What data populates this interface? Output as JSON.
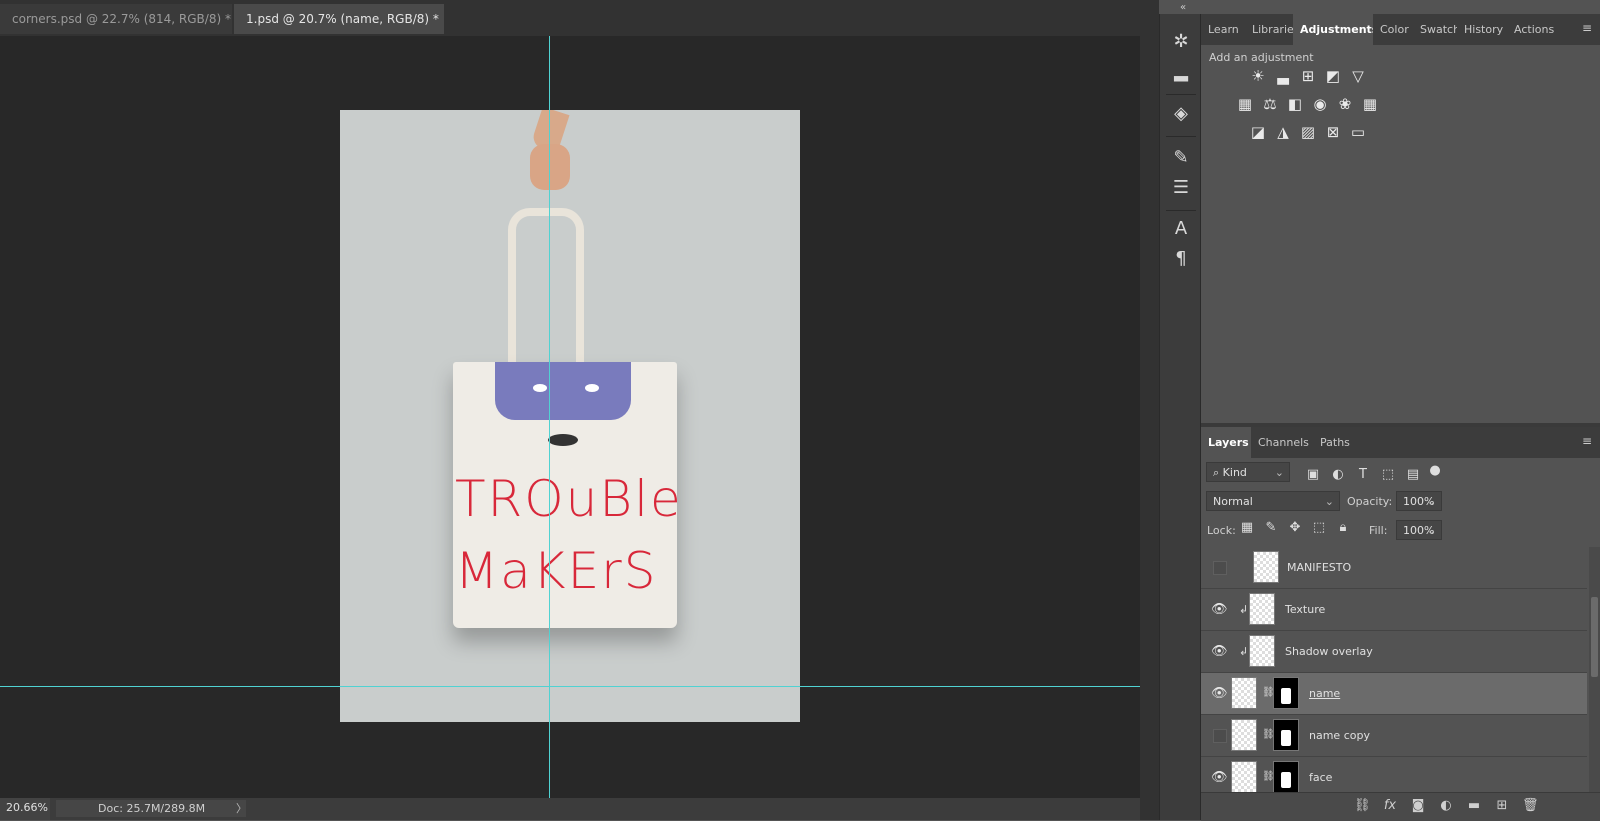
{
  "tabs": [
    {
      "label": "corners.psd @ 22.7% (814, RGB/8) *",
      "close": "×"
    },
    {
      "label": "1.psd @ 20.7% (name, RGB/8) *",
      "close": "×"
    }
  ],
  "artwork": {
    "line1": "TROuBle",
    "line2": "MaKErS"
  },
  "status": {
    "zoom": "20.66%",
    "doc": "Doc: 25.7M/289.8M",
    "arrow": "〉"
  },
  "toolstrip": {
    "collapse_icon": "«"
  },
  "panel_top": {
    "tabs": [
      "Learn",
      "Libraries",
      "Adjustments",
      "Color",
      "Swatches",
      "History",
      "Actions"
    ],
    "active_tab": "Adjustments",
    "add_label": "Add an adjustment",
    "adjustment_icons": [
      "brightness-contrast-icon",
      "levels-icon",
      "curves-icon",
      "exposure-icon",
      "vibrance-icon",
      "hue-saturation-icon",
      "color-balance-icon",
      "black-white-icon",
      "photo-filter-icon",
      "channel-mixer-icon",
      "color-lookup-icon",
      "invert-icon",
      "posterize-icon",
      "threshold-icon",
      "selective-color-icon",
      "gradient-map-icon"
    ]
  },
  "panel_layers": {
    "tabs": [
      "Layers",
      "Channels",
      "Paths"
    ],
    "active_tab": "Layers",
    "filter_kind": "Kind",
    "blend_mode": "Normal",
    "opacity_label": "Opacity:",
    "opacity": "100%",
    "lock_label": "Lock:",
    "fill_label": "Fill:",
    "fill": "100%",
    "layers": [
      {
        "name": "MANIFESTO",
        "visible": false,
        "clipped": false,
        "mask": false,
        "selected": false
      },
      {
        "name": "Texture",
        "visible": true,
        "clipped": true,
        "mask": false,
        "selected": false
      },
      {
        "name": "Shadow overlay",
        "visible": true,
        "clipped": true,
        "mask": false,
        "selected": false
      },
      {
        "name": "name",
        "visible": true,
        "clipped": false,
        "mask": true,
        "selected": true
      },
      {
        "name": "name copy",
        "visible": false,
        "clipped": false,
        "mask": true,
        "selected": false
      },
      {
        "name": "face",
        "visible": true,
        "clipped": false,
        "mask": true,
        "selected": false
      }
    ]
  },
  "colors": {
    "guide": "#50d2d2",
    "canvas_bg": "#282828",
    "panel_bg": "#535353",
    "accent_text": "#d8283a"
  }
}
